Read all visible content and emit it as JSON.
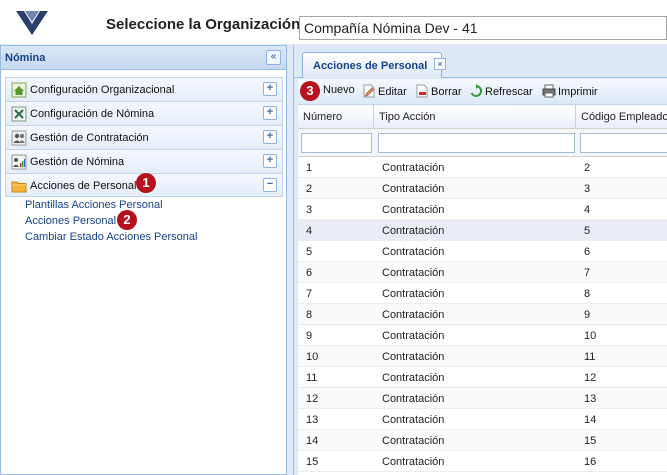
{
  "header": {
    "org_label": "Seleccione la Organización:",
    "org_value": "Compañía Nómina Dev - 41"
  },
  "sidebar": {
    "title": "Nómina",
    "collapse_glyph": "«",
    "items": [
      {
        "label": "Configuración Organizacional",
        "icon": "home-icon",
        "toggle": "+"
      },
      {
        "label": "Configuración de Nómina",
        "icon": "tools-icon",
        "toggle": "+"
      },
      {
        "label": "Gestión de Contratación",
        "icon": "people-icon",
        "toggle": "+"
      },
      {
        "label": "Gestión de Nómina",
        "icon": "chart-people-icon",
        "toggle": "+"
      },
      {
        "label": "Acciones de Personal",
        "icon": "folder-icon",
        "toggle": "−"
      }
    ],
    "sublinks": [
      "Plantillas Acciones Personal",
      "Acciones Personal",
      "Cambiar Estado Acciones Personal"
    ]
  },
  "steps": [
    "1",
    "2",
    "3"
  ],
  "tab": {
    "label": "Acciones de Personal",
    "close_glyph": "×"
  },
  "toolbar": {
    "nuevo": "Nuevo",
    "editar": "Editar",
    "borrar": "Borrar",
    "refrescar": "Refrescar",
    "imprimir": "Imprimir"
  },
  "grid": {
    "columns": [
      "Número",
      "Tipo Acción",
      "Código Empleado"
    ],
    "rows": [
      {
        "numero": "1",
        "tipo": "Contratación",
        "codigo": "2"
      },
      {
        "numero": "2",
        "tipo": "Contratación",
        "codigo": "3"
      },
      {
        "numero": "3",
        "tipo": "Contratación",
        "codigo": "4"
      },
      {
        "numero": "4",
        "tipo": "Contratación",
        "codigo": "5"
      },
      {
        "numero": "5",
        "tipo": "Contratación",
        "codigo": "6"
      },
      {
        "numero": "6",
        "tipo": "Contratación",
        "codigo": "7"
      },
      {
        "numero": "7",
        "tipo": "Contratación",
        "codigo": "8"
      },
      {
        "numero": "8",
        "tipo": "Contratación",
        "codigo": "9"
      },
      {
        "numero": "9",
        "tipo": "Contratación",
        "codigo": "10"
      },
      {
        "numero": "10",
        "tipo": "Contratación",
        "codigo": "11"
      },
      {
        "numero": "11",
        "tipo": "Contratación",
        "codigo": "12"
      },
      {
        "numero": "12",
        "tipo": "Contratación",
        "codigo": "13"
      },
      {
        "numero": "13",
        "tipo": "Contratación",
        "codigo": "14"
      },
      {
        "numero": "14",
        "tipo": "Contratación",
        "codigo": "15"
      },
      {
        "numero": "15",
        "tipo": "Contratación",
        "codigo": "16"
      }
    ]
  },
  "colors": {
    "accent": "#15428b",
    "step_badge": "#b5121b",
    "panel_border": "#99bbe8"
  }
}
